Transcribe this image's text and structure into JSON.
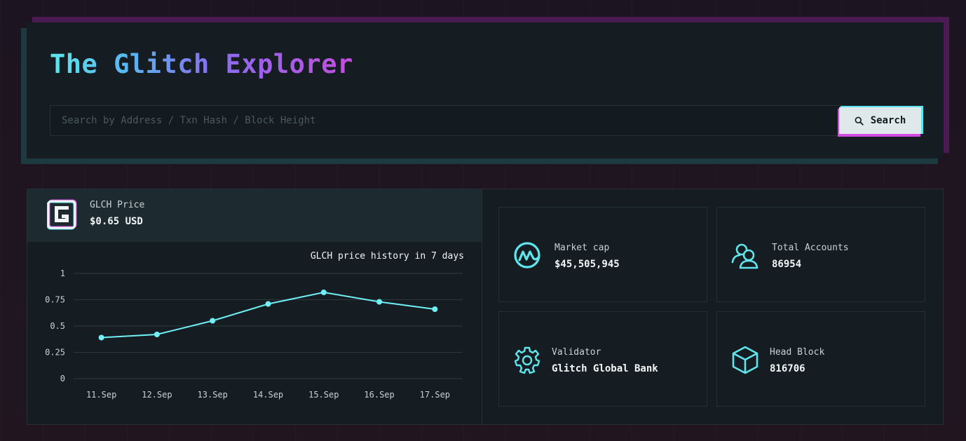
{
  "header": {
    "title_parts": [
      "The ",
      "Glitch ",
      "Explorer"
    ],
    "search_placeholder": "Search by Address / Txn Hash / Block Height",
    "search_button": "Search"
  },
  "price": {
    "label": "GLCH Price",
    "value": "$0.65 USD",
    "logo": "glitch-g-logo"
  },
  "chart_data": {
    "type": "line",
    "title": "GLCH price history in 7 days",
    "categories": [
      "11.Sep",
      "12.Sep",
      "13.Sep",
      "14.Sep",
      "15.Sep",
      "16.Sep",
      "17.Sep"
    ],
    "series": [
      {
        "values": [
          0.39,
          0.42,
          0.55,
          0.71,
          0.82,
          0.73,
          0.66
        ]
      }
    ],
    "yticks": [
      "0",
      "0.25",
      "0.5",
      "0.75",
      "1"
    ],
    "ylim": [
      0,
      1
    ],
    "grid": true,
    "color": "#6ff0f4"
  },
  "cards": [
    {
      "label": "Market cap",
      "value": "$45,505,945",
      "icon": "coinmarketcap-icon"
    },
    {
      "label": "Total Accounts",
      "value": "86954",
      "icon": "users-icon"
    },
    {
      "label": "Validator",
      "value": "Glitch Global Bank",
      "icon": "gear-icon"
    },
    {
      "label": "Head Block",
      "value": "816706",
      "icon": "cube-icon"
    }
  ],
  "colors": {
    "accent_cyan": "#5fe6ec",
    "accent_magenta": "#d24ae0",
    "panel": "#151d22"
  }
}
